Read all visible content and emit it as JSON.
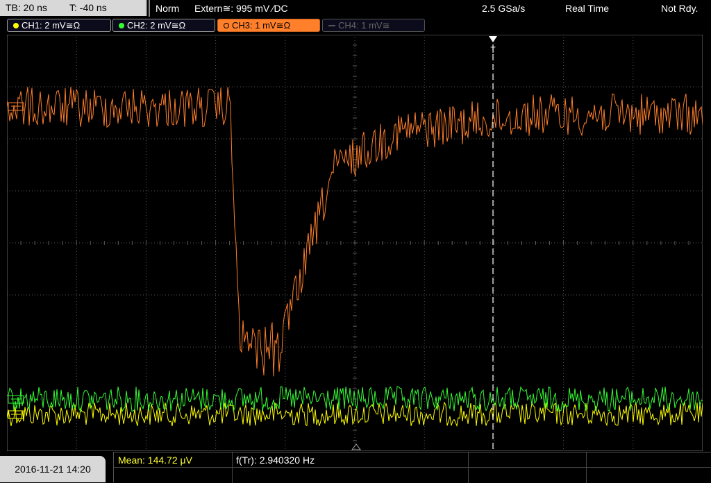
{
  "timebase": {
    "tb_label": "TB: 20 ns",
    "trigger_offset_label": "T: -40 ns"
  },
  "status": {
    "trigger_mode": "Norm",
    "trigger_source": "Extern≅: 995 mV ⁄DC",
    "sample_rate": "2.5 GSa/s",
    "acquisition_mode": "Real Time",
    "ready_state": "Not Rdy."
  },
  "channels": [
    {
      "label": "CH1: 2 mV≅Ω",
      "color": "#ffff00",
      "state": "on"
    },
    {
      "label": "CH2: 2 mV≅Ω",
      "color": "#33ff33",
      "state": "on"
    },
    {
      "label": "CH3: 1 mV≅Ω",
      "color": "#ff7f2a",
      "state": "active"
    },
    {
      "label": "CH4: 1 mV≅",
      "color": "#666666",
      "state": "off"
    }
  ],
  "trigger_marker": {
    "glyph": "T"
  },
  "measurements": {
    "mean": "Mean: 144.72 μV",
    "frequency": "f(Tr): 2.940320 Hz"
  },
  "datetime": "2016-11-21 14:20",
  "colors": {
    "ch1": "#ffff00",
    "ch2": "#33ff33",
    "ch3": "#ff7f2a",
    "grid": "#5a5a5a",
    "trigger": "#ffffff"
  }
}
